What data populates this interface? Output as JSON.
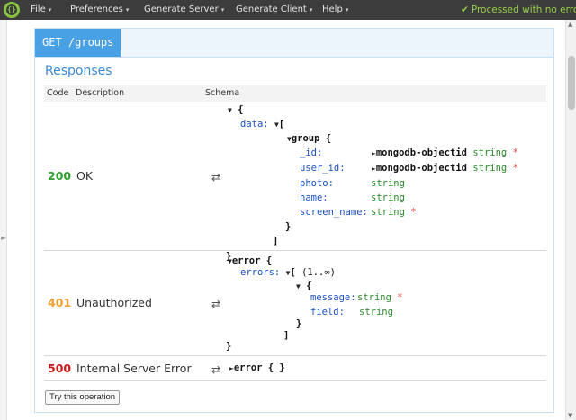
{
  "menubar": {
    "items": [
      {
        "label": "File"
      },
      {
        "label": "Preferences"
      },
      {
        "label": "Generate Server"
      },
      {
        "label": "Generate Client"
      },
      {
        "label": "Help"
      }
    ],
    "status": "Processed with no error"
  },
  "operation": {
    "method_path": "GET /groups"
  },
  "responses": {
    "title": "Responses",
    "headers": {
      "code": "Code",
      "description": "Description",
      "schema": "Schema"
    },
    "rows": [
      {
        "code": "200",
        "description": "OK",
        "code_color": "#2ea02e"
      },
      {
        "code": "401",
        "description": "Unauthorized",
        "code_color": "#f0a030"
      },
      {
        "code": "500",
        "description": "Internal Server Error",
        "code_color": "#cc1a1a"
      }
    ],
    "swap_glyph": "⇄"
  },
  "schema_200": {
    "open_brace": "{",
    "data_key": "data:",
    "open_bracket": "[",
    "group_label": "group {",
    "fields": [
      {
        "key": "_id:",
        "type": "mongodb-objectid",
        "type2": "string",
        "required": "*",
        "ref": true
      },
      {
        "key": "user_id:",
        "type": "mongodb-objectid",
        "type2": "string",
        "required": "*",
        "ref": true
      },
      {
        "key": "photo:",
        "type": "",
        "type2": "string",
        "required": "",
        "ref": false
      },
      {
        "key": "name:",
        "type": "",
        "type2": "string",
        "required": "",
        "ref": false
      },
      {
        "key": "screen_name:",
        "type": "",
        "type2": "string",
        "required": "*",
        "ref": false
      }
    ],
    "close_group": "}",
    "close_bracket": "]",
    "close_brace": "}"
  },
  "schema_401": {
    "label": "error {",
    "errors_key": "errors:",
    "open_bracket": "[",
    "range": "(1..∞)",
    "open_brace": "{",
    "fields": [
      {
        "key": "message:",
        "type": "string",
        "required": "*"
      },
      {
        "key": "field:",
        "type": "string",
        "required": ""
      }
    ],
    "close_inner": "}",
    "close_bracket": "]",
    "close_brace": "}"
  },
  "schema_500": {
    "label": "error { }"
  },
  "try_button": "Try this operation",
  "glyphs": {
    "caret": "▾",
    "triangle_down": "▼",
    "triangle_right": "►",
    "check": "✔"
  }
}
